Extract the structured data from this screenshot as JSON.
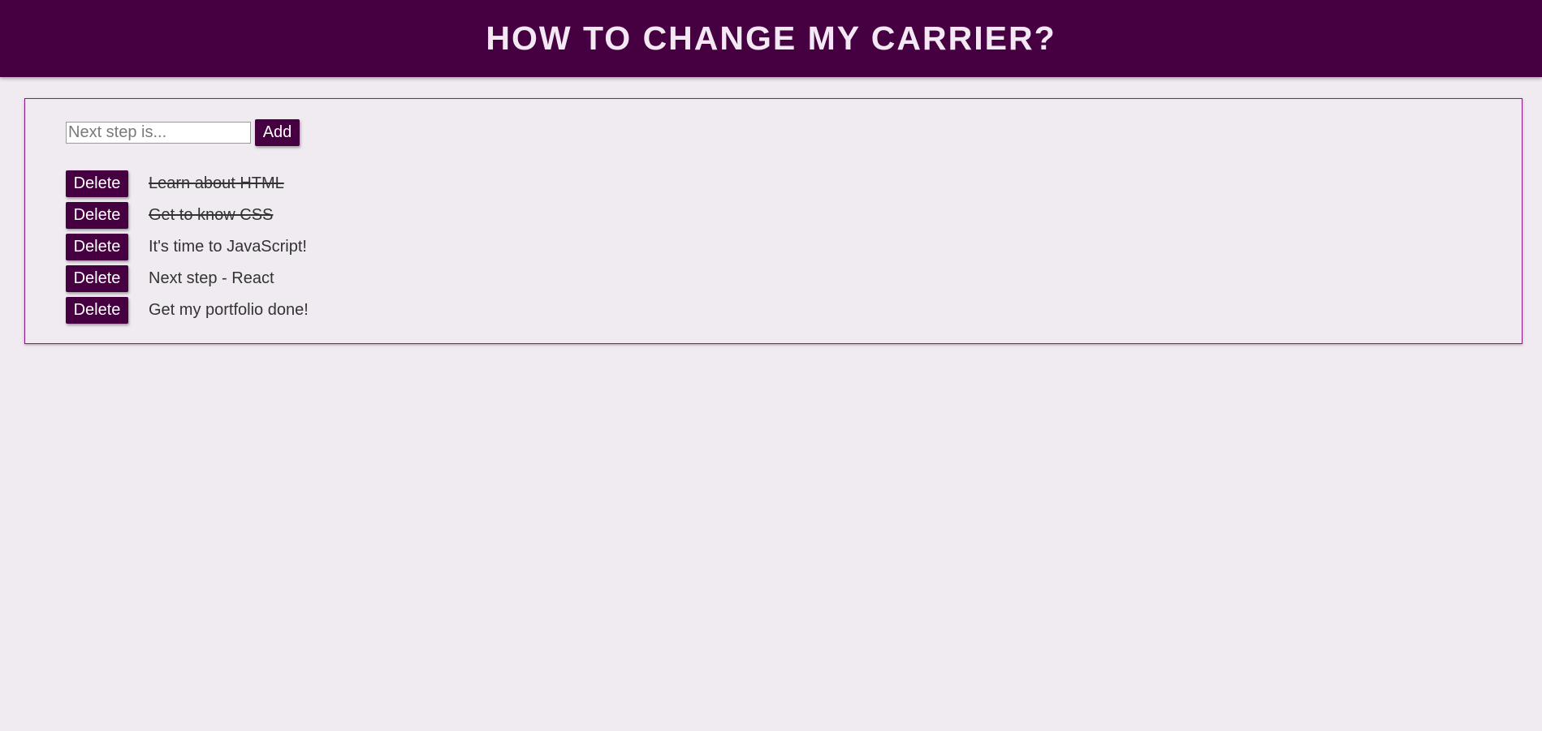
{
  "header": {
    "title": "HOW TO CHANGE MY CARRIER?"
  },
  "form": {
    "placeholder": "Next step is...",
    "value": "",
    "add_label": "Add"
  },
  "steps": [
    {
      "text": "Learn about HTML",
      "done": true,
      "delete_label": "Delete"
    },
    {
      "text": "Get to know CSS",
      "done": true,
      "delete_label": "Delete"
    },
    {
      "text": "It's time to JavaScript!",
      "done": false,
      "delete_label": "Delete"
    },
    {
      "text": "Next step - React",
      "done": false,
      "delete_label": "Delete"
    },
    {
      "text": "Get my portfolio done!",
      "done": false,
      "delete_label": "Delete"
    }
  ],
  "colors": {
    "accent": "#460042",
    "background": "#f0ebf0",
    "panel_border": "#8a1a86"
  }
}
